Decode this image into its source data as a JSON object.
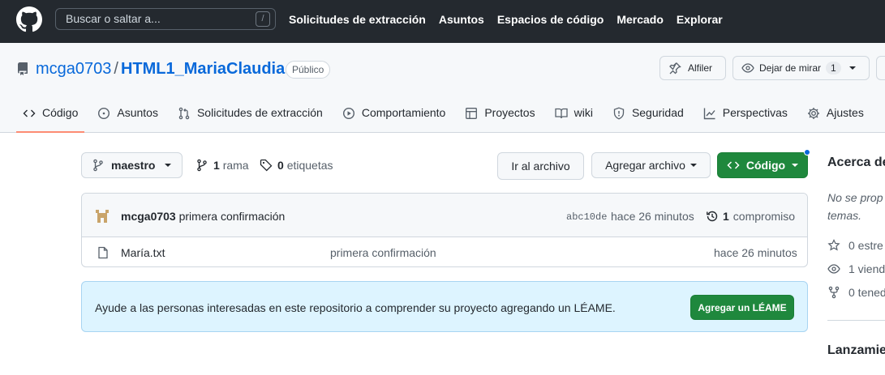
{
  "header": {
    "search_placeholder": "Buscar o saltar a...",
    "search_shortcut": "/",
    "nav": [
      "Solicitudes de extracción",
      "Asuntos",
      "Espacios de código",
      "Mercado",
      "Explorar"
    ]
  },
  "repo": {
    "owner": "mcga0703",
    "separator": "/",
    "name": "HTML1_MariaClaudia",
    "visibility": "Público",
    "pin_label": "Alfiler",
    "watch_label": "Dejar de mirar",
    "watch_count": "1"
  },
  "tabs": [
    {
      "label": "Código",
      "icon": "code-icon"
    },
    {
      "label": "Asuntos",
      "icon": "issue-icon"
    },
    {
      "label": "Solicitudes de extracción",
      "icon": "pull-request-icon"
    },
    {
      "label": "Comportamiento",
      "icon": "play-icon"
    },
    {
      "label": "Proyectos",
      "icon": "table-icon"
    },
    {
      "label": "wiki",
      "icon": "book-icon"
    },
    {
      "label": "Seguridad",
      "icon": "shield-icon"
    },
    {
      "label": "Perspectivas",
      "icon": "graph-icon"
    },
    {
      "label": "Ajustes",
      "icon": "gear-icon"
    }
  ],
  "branch": {
    "name": "maestro",
    "branches_count": "1",
    "branches_label": "rama",
    "tags_count": "0",
    "tags_label": "etiquetas"
  },
  "actions": {
    "goto_file": "Ir al archivo",
    "add_file": "Agregar archivo",
    "code": "Código"
  },
  "commit": {
    "author": "mcga0703",
    "message": "primera confirmación",
    "hash": "abc10de",
    "time": "hace 26 minutos",
    "count": "1",
    "count_label": "compromiso"
  },
  "files": [
    {
      "name": "María.txt",
      "message": "primera confirmación",
      "time": "hace 26 minutos"
    }
  ],
  "readme_banner": {
    "text": "Ayude a las personas interesadas en este repositorio a comprender su proyecto agregando un LÉAME.",
    "button": "Agregar un LÉAME"
  },
  "sidebar": {
    "about_title": "Acerca de",
    "description": "No se proporcionó descripción, sitio web o temas.",
    "description_line1": "No se prop",
    "description_line2": "temas.",
    "stars": "0 estre",
    "watchers": "1 viend",
    "forks": "0 tened",
    "releases": "Lanzamien"
  },
  "colors": {
    "header_bg": "#24292f",
    "link": "#0969da",
    "accent_underline": "#fd8c73",
    "green": "#1f883d",
    "banner_bg": "#ddf4ff"
  }
}
